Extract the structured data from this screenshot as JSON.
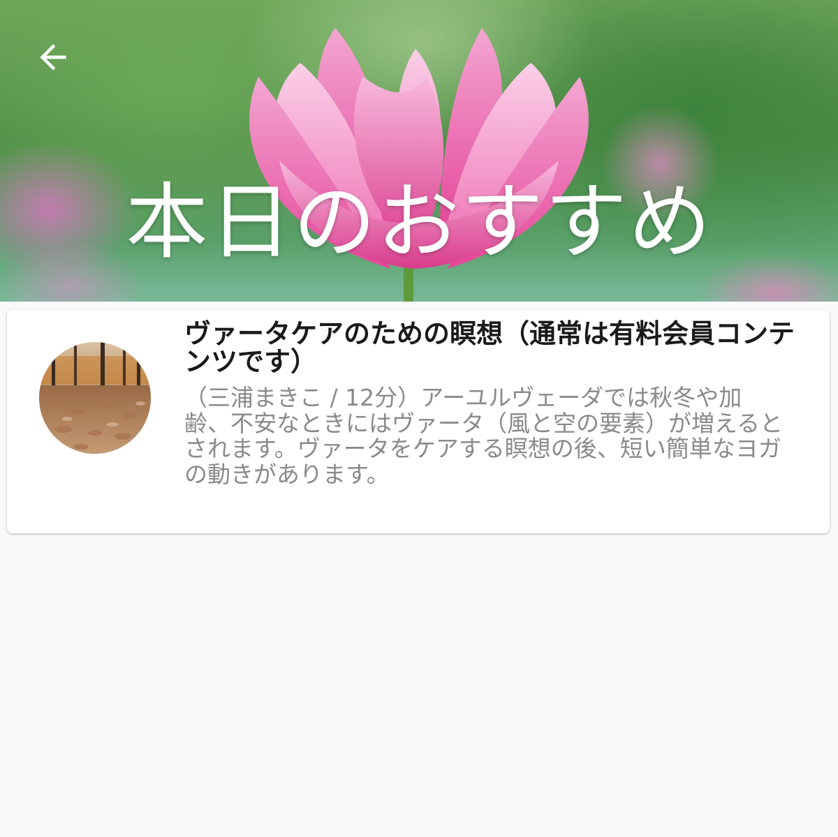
{
  "header": {
    "back_icon": "arrow-left-icon",
    "title": "本日のおすすめ",
    "background_image": "pink-lotus-flower"
  },
  "items": [
    {
      "title": "ヴァータケアのための瞑想（通常は有料会員コンテンツです）",
      "description": "（三浦まきこ / 12分）アーユルヴェーダでは秋冬や加齢、不安なときにはヴァータ（風と空の要素）が増えるとされます。ヴァータをケアする瞑想の後、短い簡単なヨガの動きがあります。",
      "thumbnail": "autumn-leaves-forest"
    }
  ],
  "colors": {
    "title_text": "#1a1a1a",
    "description_text": "#8a8a8a",
    "page_background": "#f9f9f9",
    "card_background": "#ffffff",
    "lotus_pink": "#e8559c"
  }
}
